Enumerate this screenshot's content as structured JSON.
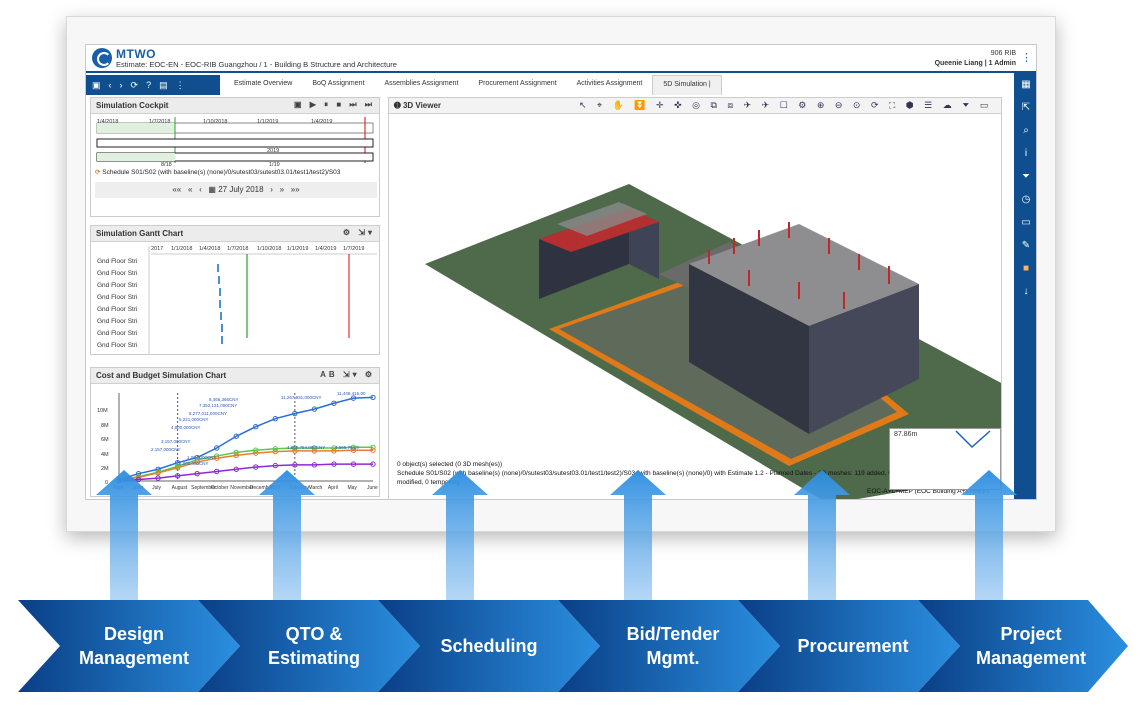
{
  "app": {
    "brand": "MTWO",
    "breadcrumb": "Estimate: EOC-EN - EOC-RIB Guangzhou / 1 - Building B Structure and Architecture",
    "company": "906 RIB",
    "user": "Queenie Liang | 1 Admin"
  },
  "tabs": [
    {
      "label": "Estimate Overview"
    },
    {
      "label": "BoQ Assignment"
    },
    {
      "label": "Assemblies Assignment"
    },
    {
      "label": "Procurement Assignment"
    },
    {
      "label": "Activities Assignment"
    },
    {
      "label": "5D Simulation |"
    }
  ],
  "cockpit": {
    "title": "Simulation Cockpit",
    "timeline_labels": [
      "1/4/2018",
      "1/7/2018",
      "1/10/2018",
      "1/1/2019",
      "1/4/2019"
    ],
    "row2_left": "2019",
    "row3_left": "8/18",
    "row3_right": "1/19",
    "schedule": "Schedule S01/S02 (with baseline(s) (none)/0/sutest03/sutest03.01/test1/test2)/S03",
    "date": "27 July 2018"
  },
  "gantt": {
    "title": "Simulation Gantt Chart",
    "header": [
      "2017",
      "1/1/2018",
      "1/4/2018",
      "1/7/2018",
      "1/10/2018",
      "1/1/2019",
      "1/4/2019",
      "1/7/2019"
    ],
    "rows": [
      "Gnd Floor Stri",
      "Gnd Floor Stri",
      "Gnd Floor Stri",
      "Gnd Floor Stri",
      "Gnd Floor Stri",
      "Gnd Floor Stri",
      "Gnd Floor Stri",
      "Gnd Floor Stri"
    ]
  },
  "cost": {
    "title": "Cost and Budget Simulation Chart",
    "ab_label": "AB",
    "y_ticks": [
      "10M",
      "8M",
      "6M",
      "4M",
      "2M",
      "0"
    ],
    "x_ticks": [
      "April",
      "June",
      "July",
      "August",
      "September",
      "October",
      "November",
      "December",
      "2019",
      "February",
      "March",
      "April",
      "May",
      "June"
    ],
    "annotations": [
      "8,466,366CNY",
      "7,352,131,000CNY",
      "6,277,011,000CNY",
      "5,221,000CNY",
      "4,800,000CNY",
      "11,267,931,000CNY",
      "11,449,415,00",
      "4,566,764,000CNY",
      "4,566,764,0",
      "3,157,000CNY",
      "2,157,000CNY",
      "1,094,000CNY",
      "1,000,000CNY"
    ]
  },
  "chart_data": {
    "type": "line",
    "title": "Cost and Budget Simulation Chart",
    "xlabel": "",
    "ylabel": "",
    "ylim": [
      0,
      10
    ],
    "categories": [
      "April",
      "June",
      "July",
      "August",
      "September",
      "October",
      "November",
      "December",
      "2019",
      "February",
      "March",
      "April",
      "May",
      "June"
    ],
    "series": [
      {
        "values": [
          0.2,
          1.0,
          1.6,
          2.5,
          3.2,
          4.5,
          6.1,
          7.4,
          8.5,
          9.2,
          9.8,
          10.6,
          11.3,
          11.4
        ]
      },
      {
        "values": [
          0.1,
          0.6,
          1.2,
          2.0,
          2.9,
          3.4,
          3.9,
          4.2,
          4.4,
          4.5,
          4.5,
          4.5,
          4.6,
          4.6
        ]
      },
      {
        "values": [
          0.1,
          0.5,
          1.1,
          1.8,
          2.6,
          3.1,
          3.5,
          3.8,
          4.0,
          4.1,
          4.1,
          4.1,
          4.2,
          4.2
        ]
      },
      {
        "values": [
          0.0,
          0.2,
          0.4,
          0.7,
          1.0,
          1.3,
          1.6,
          1.9,
          2.1,
          2.2,
          2.2,
          2.3,
          2.3,
          2.3
        ]
      }
    ]
  },
  "viewer": {
    "title": "3D Viewer",
    "status_lines": [
      "0 object(s) selected (0 3D mesh(es))",
      "Schedule S01/S02 (with baseline(s) (none)/0/sutest03/sutest03.01/test1/test2)/S03 (with baseline(s) (none)/0) with Estimate 1.2 - Planned Dates - 3D meshes: 119 added, 0 removed, 0",
      "modified, 0 temporary",
      "EOC-A+L+MEP (EOC Building A+L+MEP)"
    ],
    "scale": "87.86m"
  },
  "process": [
    {
      "line1": "Design",
      "line2": "Management"
    },
    {
      "line1": "QTO &",
      "line2": "Estimating"
    },
    {
      "line1": "Scheduling",
      "line2": ""
    },
    {
      "line1": "Bid/Tender",
      "line2": "Mgmt."
    },
    {
      "line1": "Procurement",
      "line2": ""
    },
    {
      "line1": "Project",
      "line2": "Management"
    }
  ],
  "colors": {
    "brand": "#0f4f8f",
    "chevron_dark": "#0a3f86",
    "chevron_light": "#2b8fe0"
  }
}
